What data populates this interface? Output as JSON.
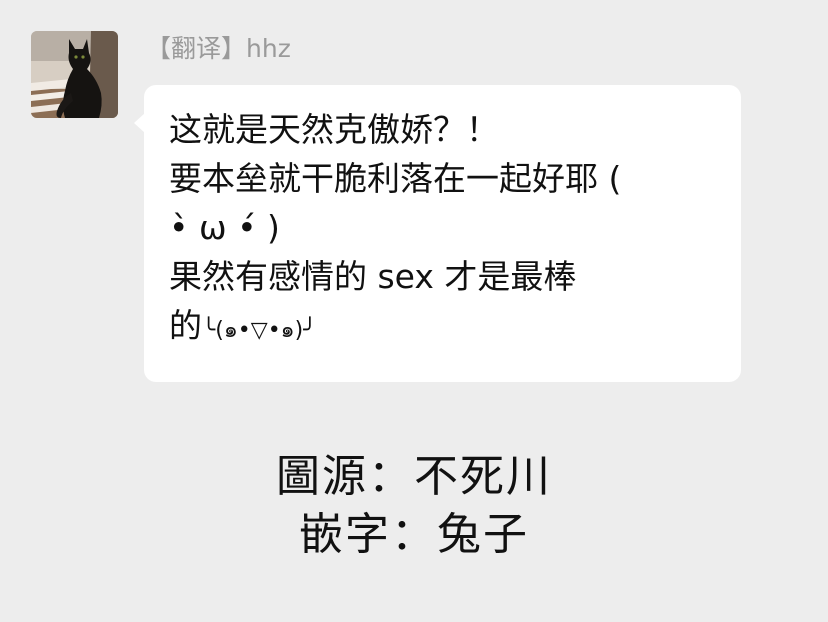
{
  "message": {
    "sender": "【翻译】hhz",
    "lines": [
      "这就是天然克傲娇？！",
      "要本垒就干脆利落在一起好耶 (",
      "•̀ ω •́ )",
      "果然有感情的 sex 才是最棒",
      "的"
    ],
    "trailing_kaomoji": "╰(๑•▽•๑)╯"
  },
  "credits": {
    "source": "圖源：不死川",
    "typeset": "嵌字：兔子"
  },
  "colors": {
    "background": "#ededed",
    "bubble": "#ffffff",
    "sender_text": "#9a9a9a",
    "message_text": "#111111"
  },
  "icons": {
    "avatar": "black-cat-avatar"
  }
}
